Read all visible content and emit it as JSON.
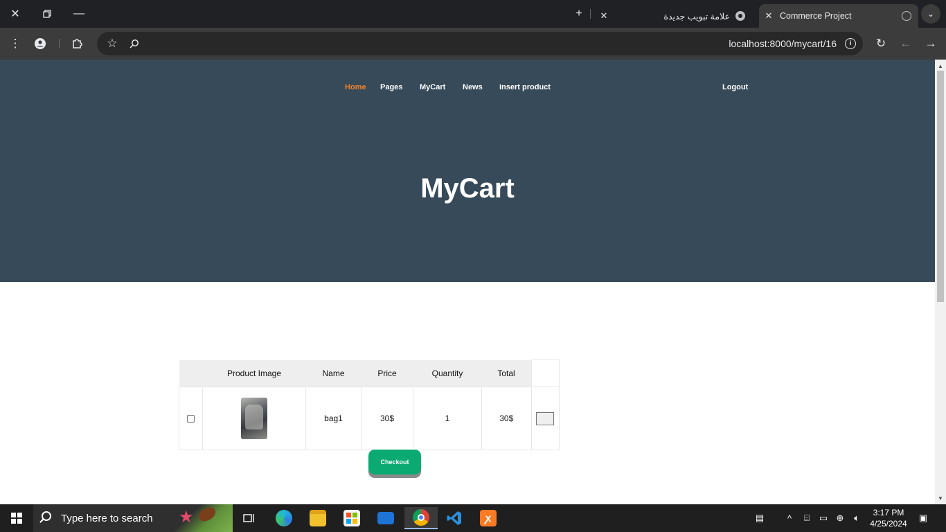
{
  "browser": {
    "tabs": [
      {
        "title": "Commerce Project",
        "active": true
      },
      {
        "title": "علامة تبويب جديدة",
        "active": false
      }
    ],
    "url": "localhost:8000/mycart/16"
  },
  "page": {
    "nav": {
      "items": [
        "Home",
        "Pages",
        "MyCart",
        "News",
        "insert product"
      ],
      "active": "Home",
      "logout_label": "Logout"
    },
    "hero_title": "MyCart",
    "cart": {
      "headers": [
        "Product Image",
        "Name",
        "Price",
        "Quantity",
        "Total"
      ],
      "rows": [
        {
          "name": "bag1",
          "price": "30$",
          "quantity": "1",
          "total": "30$",
          "checked": false
        }
      ],
      "checkout_label": "Checkout"
    }
  },
  "taskbar": {
    "search_placeholder": "Type here to search",
    "time": "3:17 PM",
    "date": "4/25/2024",
    "apps": [
      "task-view",
      "edge",
      "file-explorer",
      "microsoft-store",
      "mail",
      "chrome",
      "vscode",
      "xampp"
    ]
  },
  "colors": {
    "hero_bg": "#374a59",
    "nav_active": "#f1832c",
    "checkout_bg": "#0baa73",
    "browser_frame": "#202124"
  }
}
